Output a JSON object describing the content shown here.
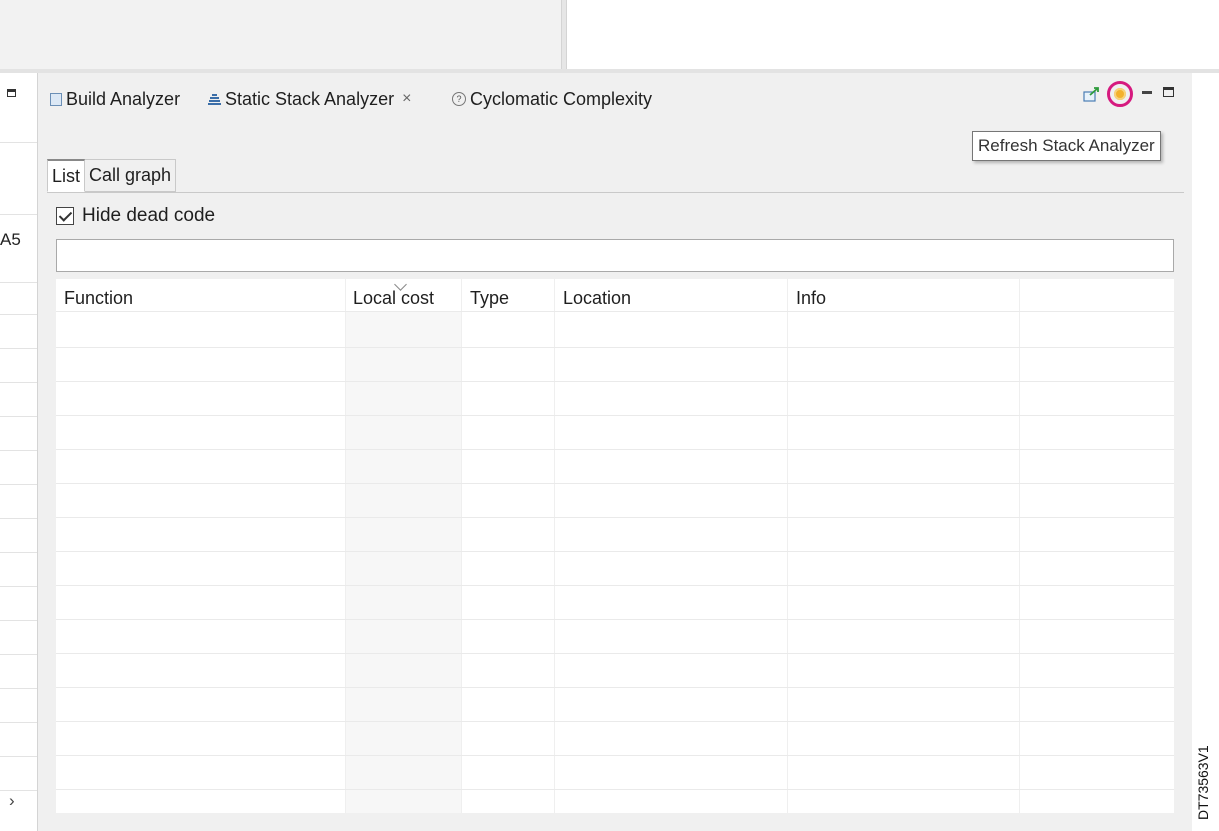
{
  "left_pane": {
    "text": "A5",
    "arrow": "›"
  },
  "tabs": [
    {
      "label": "Build Analyzer",
      "icon": "build-analyzer-icon"
    },
    {
      "label": "Static Stack Analyzer",
      "icon": "stack-icon",
      "active": true,
      "close": "×"
    },
    {
      "label": "Cyclomatic Complexity",
      "icon": "cyclomatic-icon"
    }
  ],
  "toolbar": {
    "export_icon": "export-icon",
    "refresh_icon": "refresh-icon",
    "highlight_color": "#d61a7f",
    "tooltip": "Refresh Stack Analyzer"
  },
  "subtabs": [
    {
      "label": "List",
      "active": true
    },
    {
      "label": "Call graph",
      "active": false
    }
  ],
  "hide_dead_code": {
    "label": "Hide dead code",
    "checked": true
  },
  "filter": {
    "value": ""
  },
  "table": {
    "columns": [
      "Function",
      "Local cost",
      "Type",
      "Location",
      "Info"
    ],
    "rows": []
  },
  "watermark": "DT73563V1"
}
